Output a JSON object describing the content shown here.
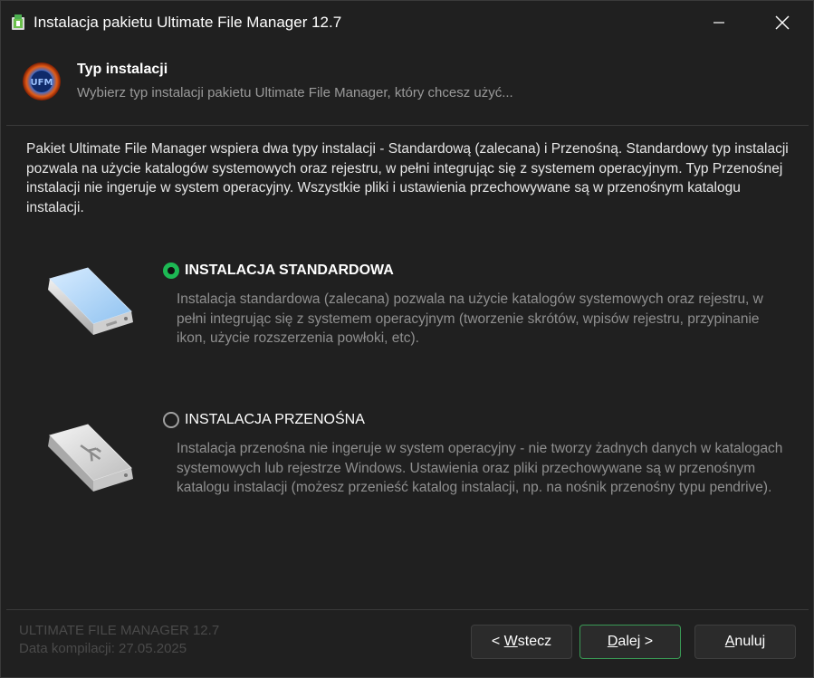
{
  "window": {
    "title": "Instalacja pakietu Ultimate File Manager 12.7",
    "minimize_icon": "minimize-icon",
    "close_icon": "close-icon"
  },
  "header": {
    "title": "Typ instalacji",
    "subtitle": "Wybierz typ instalacji pakietu Ultimate File Manager, który chcesz użyć...",
    "logo_icon": "ufm-logo-icon"
  },
  "intro": "Pakiet Ultimate File Manager wspiera dwa typy instalacji - Standardową (zalecana) i Przenośną. Standardowy typ instalacji pozwala na użycie katalogów systemowych oraz rejestru, w pełni integrując się z systemem operacyjnym. Typ Przenośnej instalacji nie ingeruje w system operacyjny. Wszystkie pliki i ustawienia przechowywane są w przenośnym katalogu instalacji.",
  "options": [
    {
      "label": "INSTALACJA STANDARDOWA",
      "checked": true,
      "icon": "hard-drive-icon",
      "description": "Instalacja standardowa (zalecana) pozwala na użycie katalogów systemowych oraz rejestru, w pełni integrując się z systemem operacyjnym (tworzenie skrótów, wpisów rejestru, przypinanie ikon, użycie rozszerzenia powłoki, etc)."
    },
    {
      "label": "INSTALACJA PRZENOŚNA",
      "checked": false,
      "icon": "usb-drive-icon",
      "description": "Instalacja przenośna nie ingeruje w system operacyjny - nie tworzy żadnych danych w katalogach systemowych lub rejestrze Windows. Ustawienia oraz pliki przechowywane są w przenośnym katalogu instalacji (możesz przenieść katalog instalacji, np. na nośnik przenośny typu pendrive)."
    }
  ],
  "footer": {
    "product": "ULTIMATE FILE MANAGER 12.7",
    "build": "Data kompilacji: 27.05.2025"
  },
  "buttons": {
    "back_prefix": "< ",
    "back_mnemonic": "W",
    "back_rest": "stecz",
    "next_mnemonic": "D",
    "next_rest": "alej >",
    "cancel_mnemonic": "A",
    "cancel_rest": "nuluj"
  },
  "colors": {
    "accent_green": "#1db954",
    "background": "#202020"
  }
}
